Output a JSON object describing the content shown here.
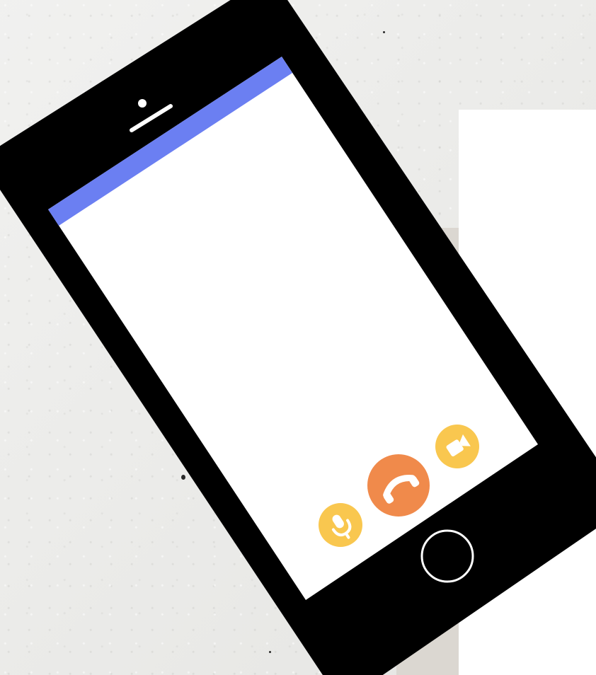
{
  "scene": {
    "background_color": "#ececea",
    "card_color": "#ffffff",
    "tan_block_color": "#dbd7d1"
  },
  "phone": {
    "body_color": "#000000",
    "screen_color": "#ffffff",
    "status_bar_color": "#6b7ff2"
  },
  "call_controls": {
    "mute_button": {
      "icon": "microphone-icon",
      "color": "#f9c74f"
    },
    "end_call_button": {
      "icon": "phone-hangup-icon",
      "color": "#f08a4b"
    },
    "video_button": {
      "icon": "video-camera-icon",
      "color": "#f9c74f"
    }
  },
  "home_button": {
    "icon": "home-button-icon"
  }
}
